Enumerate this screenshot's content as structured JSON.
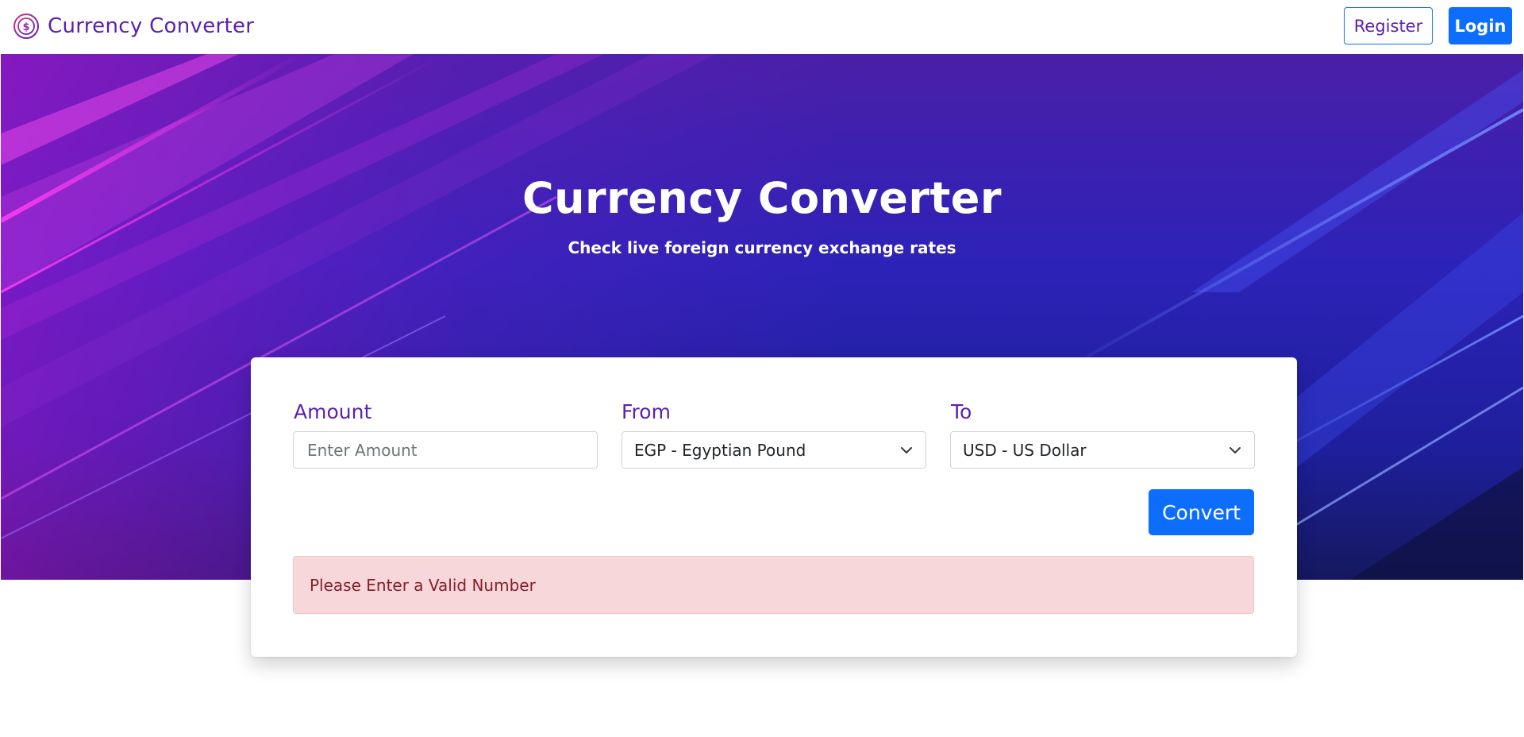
{
  "navbar": {
    "brand_text": "Currency Converter",
    "brand_icon": "dollar-coin-icon",
    "register_label": "Register",
    "login_label": "Login"
  },
  "hero": {
    "title": "Currency Converter",
    "subtitle": "Check live foreign currency exchange rates"
  },
  "converter": {
    "amount_label": "Amount",
    "amount_placeholder": "Enter Amount",
    "amount_value": "",
    "from_label": "From",
    "from_value": "EGP - Egyptian Pound",
    "to_label": "To",
    "to_value": "USD - US Dollar",
    "convert_label": "Convert",
    "alert_message": "Please Enter a Valid Number"
  },
  "colors": {
    "accent_purple": "#5a1fb3",
    "primary_blue": "#0d6efd",
    "alert_bg": "#f8d7da",
    "alert_text": "#842029"
  }
}
